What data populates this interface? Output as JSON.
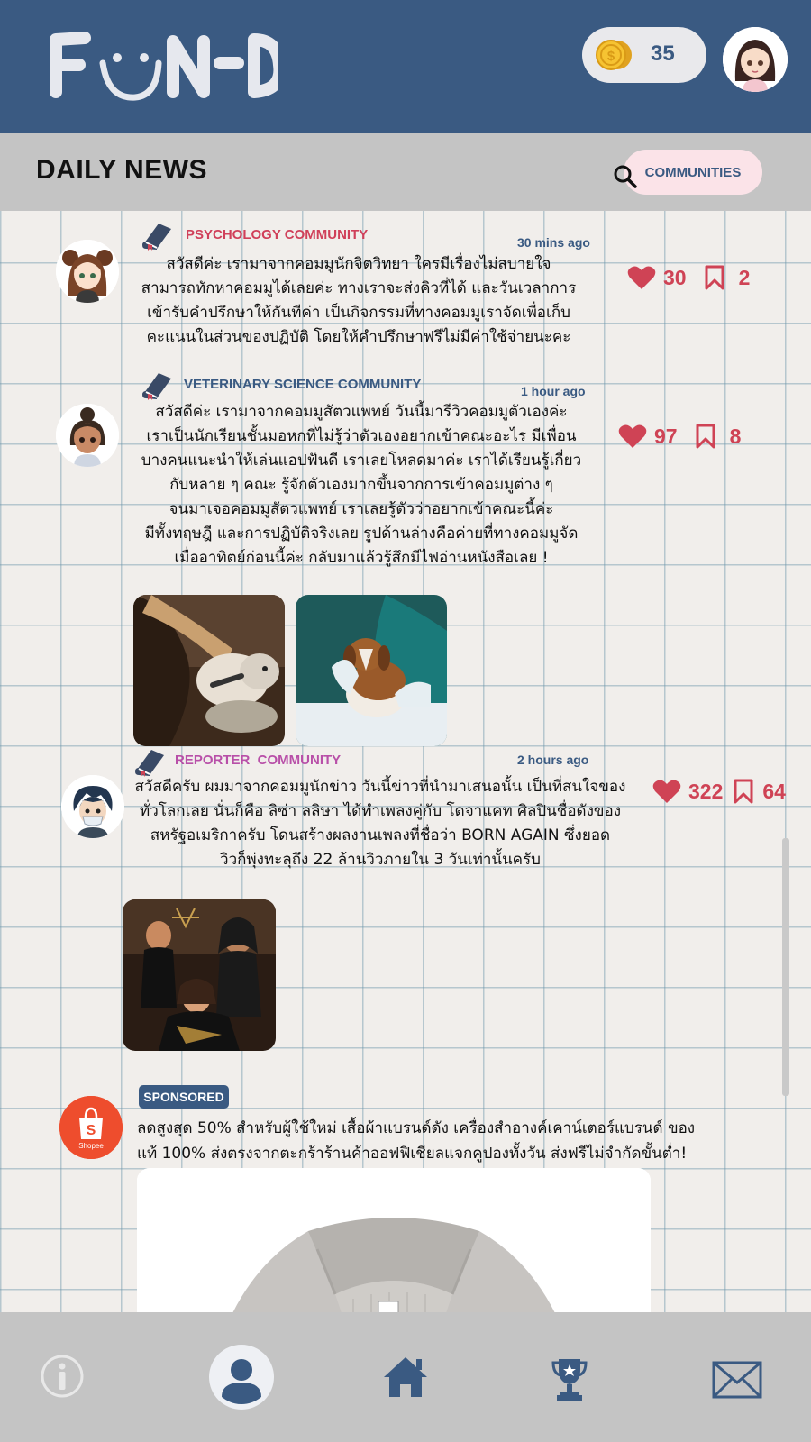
{
  "app": {
    "logo_text": "FUN-D",
    "coins": "35"
  },
  "header": {
    "title": "DAILY NEWS",
    "communities_label": "COMMUNITIES"
  },
  "colors": {
    "primary": "#3a5a82",
    "accent_red": "#cf4355",
    "pink": "#fbe3e8",
    "gray_bar": "#c4c4c4"
  },
  "posts": [
    {
      "community": "PSYCHOLOGY COMMUNITY",
      "community_color": "#d0405a",
      "time": "30 mins ago",
      "text": "สวัสดีค่ะ เรามาจากคอมมูนักจิตวิทยา ใครมีเรื่องไม่สบายใจ\nสามารถทักหาคอมมูได้เลยค่ะ  ทางเราจะส่งคิวที่ได้ และวันเวลาการ\nเข้ารับคำปรึกษาให้กันทีค่า เป็นกิจกรรมที่ทางคอมมูเราจัดเพื่อเก็บ\nคะแนนในส่วนของปฏิบัติ โดยให้คำปรึกษาฟรีไม่มีค่าใช้จ่ายนะคะ",
      "likes": "30",
      "saves": "2"
    },
    {
      "community": "VETERINARY SCIENCE COMMUNITY",
      "community_color": "#3a5a82",
      "time": "1 hour ago",
      "text": "สวัสดีค่ะ เรามาจากคอมมูสัตวแพทย์ วันนี้มารีวิวคอมมูตัวเองค่ะ\nเราเป็นนักเรียนชั้นมอหกที่ไม่รู้ว่าตัวเองอยากเข้าคณะอะไร มีเพื่อน\nบางคนแนะนำให้เล่นแอปฟันดี เราเลยโหลดมาค่ะ เราได้เรียนรู้เกี่ยว\nกับหลาย ๆ คณะ รู้จักตัวเองมากขึ้นจากการเข้าคอมมูต่าง ๆ\nจนมาเจอคอมมูสัตวแพทย์ เราเลยรู้ตัวว่าอยากเข้าคณะนี้ค่ะ\nมีทั้งทฤษฎี และการปฏิบัติจริงเลย รูปด้านล่างคือค่ายที่ทางคอมมูจัด\nเมื่ออาทิตย์ก่อนนี้ค่ะ กลับมาแล้วรู้สึกมีไฟอ่านหนังสือเลย !",
      "likes": "97",
      "saves": "8"
    },
    {
      "community": "REPORTER  COMMUNITY",
      "community_color": "#b84fa8",
      "time": "2 hours ago",
      "text": "สวัสดีครับ ผมมาจากคอมมูนักข่าว วันนี้ข่าวที่นำมาเสนอนั้น เป็นที่สนใจของ\nทั่วโลกเลย นั่นก็คือ ลิซ่า ลลิษา ได้ทำเพลงคู่กับ โดจาแคท ศิลปินชื่อดังของ\nสหรัฐอเมริกาครับ โดนสร้างผลงานเพลงที่ชื่อว่า BORN AGAIN ซึ่งยอด\nวิวก็พุ่งทะลุถึง 22 ล้านวิวภายใน 3 วันเท่านั้นครับ",
      "likes": "322",
      "saves": "64"
    }
  ],
  "ad": {
    "badge": "SPONSORED",
    "brand": "Shopee",
    "text": "ลดสูงสุด 50% สำหรับผู้ใช้ใหม่ เสื้อผ้าแบรนด์ดัง เครื่องสำอางค์เคาน์เตอร์แบรนด์ ของ\nแท้ 100% ส่งตรงจากตะกร้าร้านค้าออฟฟิเชียลแจกคูปองทั้งวัน ส่งฟรีไม่จำกัดขั้นต่ำ!"
  },
  "nav": {
    "items": [
      "info-icon",
      "profile-icon",
      "home-icon",
      "trophy-icon",
      "mail-icon"
    ]
  }
}
